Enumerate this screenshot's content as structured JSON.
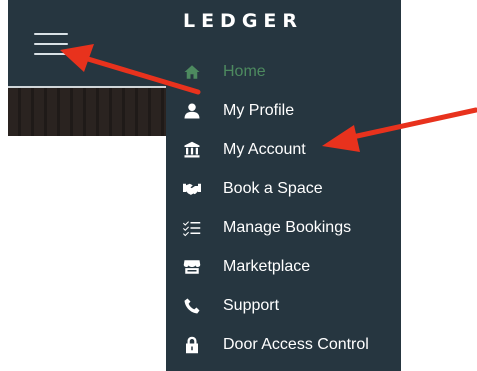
{
  "brand": "LEDGER",
  "accent_color": "#4d8a5f",
  "sidebar_bg": "#263640",
  "annotation_color": "#e8321d",
  "menu": {
    "items": [
      {
        "label": "Home",
        "icon": "home-icon",
        "active": true
      },
      {
        "label": "My Profile",
        "icon": "user-icon"
      },
      {
        "label": "My Account",
        "icon": "bank-icon"
      },
      {
        "label": "Book a Space",
        "icon": "handshake-icon"
      },
      {
        "label": "Manage Bookings",
        "icon": "checklist-icon"
      },
      {
        "label": "Marketplace",
        "icon": "store-icon"
      },
      {
        "label": "Support",
        "icon": "phone-icon"
      },
      {
        "label": "Door Access Control",
        "icon": "lock-icon"
      }
    ]
  }
}
